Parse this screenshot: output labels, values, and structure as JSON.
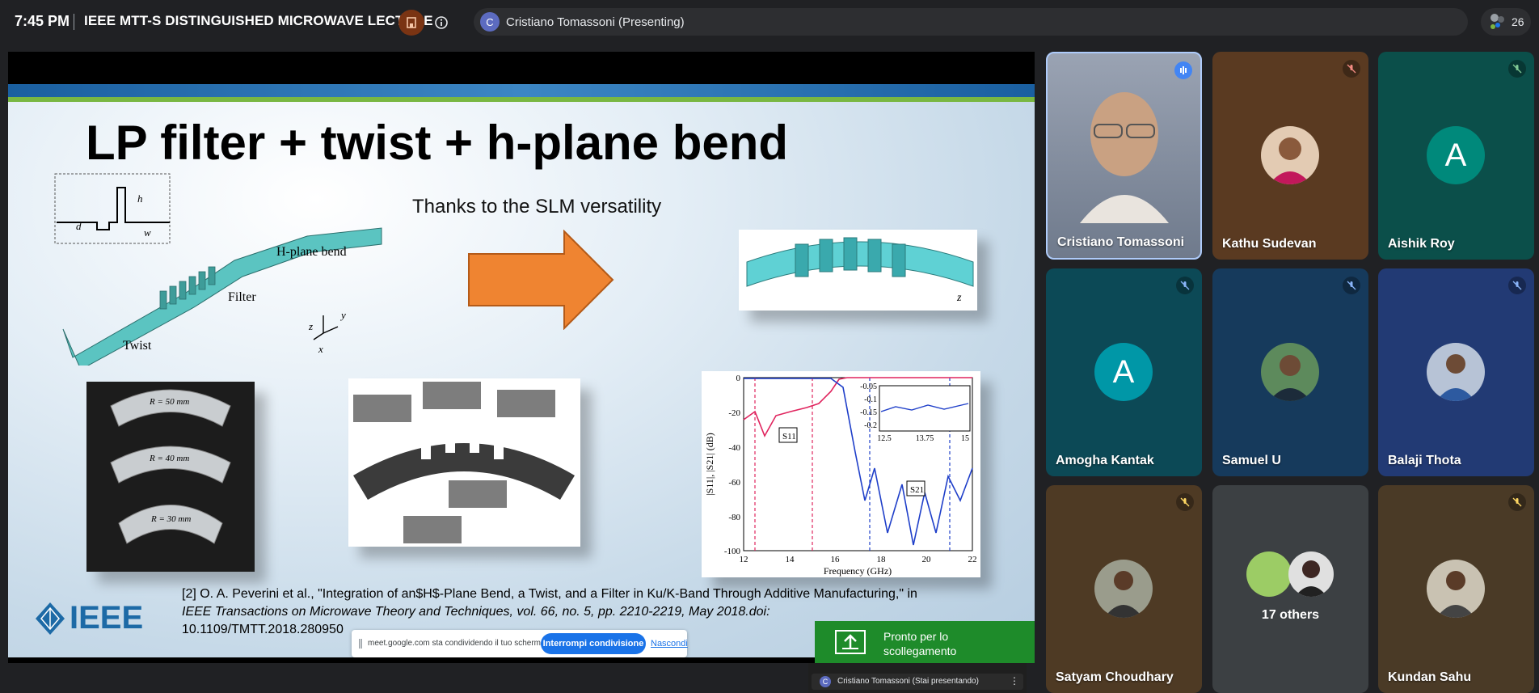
{
  "header": {
    "time": "7:45 PM",
    "meeting_title": "IEEE MTT-S DISTINGUISHED MICROWAVE LECTURE",
    "presenter_initial": "C",
    "presenter_label": "Cristiano Tomassoni (Presenting)",
    "participant_count": "26"
  },
  "slide": {
    "title": "LP filter + twist + h-plane bend",
    "subtitle": "Thanks to the SLM versatility",
    "fig1_labels": {
      "h_plane": "H-plane bend",
      "filter": "Filter",
      "twist": "Twist",
      "hk": "h",
      "dk": "d",
      "wk": "w",
      "x": "x",
      "y": "y",
      "z": "z"
    },
    "fig3_labels": {
      "r50": "R = 50 mm",
      "r40": "R = 40 mm",
      "r30": "R = 30 mm"
    },
    "plot": {
      "ylabel": "|S11|, |S21| (dB)",
      "xlabel": "Frequency (GHz)",
      "y_ticks": [
        "0",
        "-20",
        "-40",
        "-60",
        "-80",
        "-100"
      ],
      "x_ticks": [
        "12",
        "14",
        "16",
        "18",
        "20",
        "22"
      ],
      "inset_y_ticks": [
        "-0.05",
        "-0.1",
        "-0.15",
        "-0.2"
      ],
      "inset_x_ticks": [
        "12.5",
        "13.75",
        "15"
      ],
      "s11": "S11",
      "s21": "S21"
    },
    "reference_line1": "[2] O. A. Peverini et al., \"Integration of an$H$-Plane Bend, a Twist, and a Filter in Ku/K-Band Through Additive Manufacturing,\" in",
    "reference_line2": "IEEE Transactions on Microwave Theory and Techniques, vol. 66, no. 5, pp. 2210-2219, May 2018.doi:",
    "reference_line3": "10.1109/TMTT.2018.280950",
    "logo_text": "IEEE"
  },
  "share_bar": {
    "message": "meet.google.com sta condividendo il tuo schermo.",
    "stop_label": "Interrompi condivisione",
    "hide_label": "Nascondi"
  },
  "toast": {
    "text": "Pronto per lo scollegamento"
  },
  "mini_panel": {
    "initial": "C",
    "label": "Cristiano Tomassoni (Stai presentando)"
  },
  "participants": [
    {
      "name": "Cristiano Tomassoni",
      "bg": "#8c96a8",
      "status": "speaking"
    },
    {
      "name": "Kathu Sudevan",
      "bg": "#5a3a21",
      "status": "muted"
    },
    {
      "name": "Aishik Roy",
      "bg": "#0b4f4a",
      "initial": "A",
      "avatar_color": "#00897b",
      "status": "muted"
    },
    {
      "name": "Amogha Kantak",
      "bg": "#0c4956",
      "initial": "A",
      "avatar_color": "#0097a7",
      "status": "muted"
    },
    {
      "name": "Samuel U",
      "bg": "#163a5c",
      "status": "muted"
    },
    {
      "name": "Balaji Thota",
      "bg": "#223a74",
      "status": "muted"
    },
    {
      "name": "Satyam Choudhary",
      "bg": "#4e3a24",
      "status": "muted"
    },
    {
      "name": "17 others",
      "bg": "#3c4043",
      "status": "none"
    },
    {
      "name": "Kundan Sahu",
      "bg": "#4a3a26",
      "status": "muted"
    }
  ]
}
